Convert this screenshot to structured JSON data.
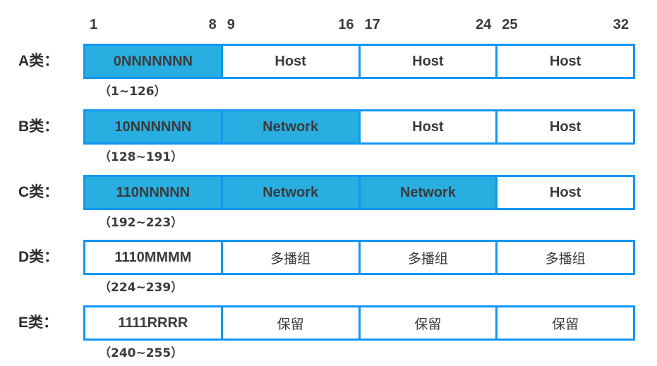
{
  "diagram": {
    "title": "IP address class structure",
    "colors": {
      "border": "#1196f3",
      "fill": "#29aee2",
      "cell_bg": "#ffffff",
      "text": "#3b3b3b"
    },
    "bit_ruler": [
      {
        "start": "1",
        "end": "8"
      },
      {
        "start": "9",
        "end": "16"
      },
      {
        "start": "17",
        "end": "24"
      },
      {
        "start": "25",
        "end": "32"
      }
    ],
    "rows": [
      {
        "label": "A类：",
        "range": "（1~126）",
        "cells": [
          {
            "text": "0NNNNNNN",
            "filled": true,
            "cjk": false
          },
          {
            "text": "Host",
            "filled": false,
            "cjk": false
          },
          {
            "text": "Host",
            "filled": false,
            "cjk": false
          },
          {
            "text": "Host",
            "filled": false,
            "cjk": false
          }
        ]
      },
      {
        "label": "B类：",
        "range": "（128~191）",
        "cells": [
          {
            "text": "10NNNNNN",
            "filled": true,
            "cjk": false
          },
          {
            "text": "Network",
            "filled": true,
            "cjk": false
          },
          {
            "text": "Host",
            "filled": false,
            "cjk": false
          },
          {
            "text": "Host",
            "filled": false,
            "cjk": false
          }
        ]
      },
      {
        "label": "C类：",
        "range": "（192~223）",
        "cells": [
          {
            "text": "110NNNNN",
            "filled": true,
            "cjk": false
          },
          {
            "text": "Network",
            "filled": true,
            "cjk": false
          },
          {
            "text": "Network",
            "filled": true,
            "cjk": false
          },
          {
            "text": "Host",
            "filled": false,
            "cjk": false
          }
        ]
      },
      {
        "label": "D类：",
        "range": "（224~239）",
        "cells": [
          {
            "text": "1110MMMM",
            "filled": false,
            "cjk": false
          },
          {
            "text": "多播组",
            "filled": false,
            "cjk": true
          },
          {
            "text": "多播组",
            "filled": false,
            "cjk": true
          },
          {
            "text": "多播组",
            "filled": false,
            "cjk": true
          }
        ]
      },
      {
        "label": "E类：",
        "range": "（240~255）",
        "cells": [
          {
            "text": "1111RRRR",
            "filled": false,
            "cjk": false
          },
          {
            "text": "保留",
            "filled": false,
            "cjk": true
          },
          {
            "text": "保留",
            "filled": false,
            "cjk": true
          },
          {
            "text": "保留",
            "filled": false,
            "cjk": true
          }
        ]
      }
    ]
  }
}
